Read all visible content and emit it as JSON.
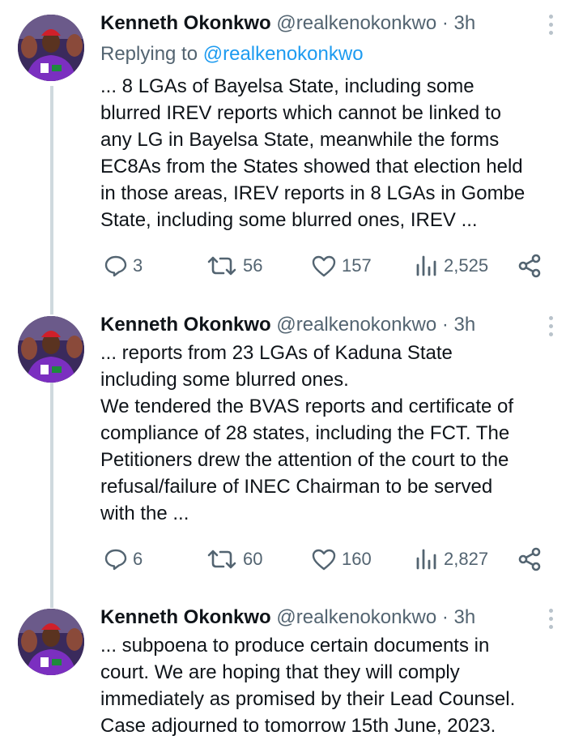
{
  "tweets": [
    {
      "name": "Kenneth Okonkwo",
      "handle": "@realkenokonkwo",
      "dot": "·",
      "time": "3h",
      "replying_prefix": "Replying to",
      "replying_to": "@realkenokonkwo",
      "lines": [
        "... 8 LGAs of Bayelsa State, including some",
        "blurred IREV reports which cannot be linked to",
        "any LG in Bayelsa State, meanwhile the forms",
        "EC8As from the States showed that election held",
        "in those areas, IREV reports in 8 LGAs in Gombe",
        "State, including some blurred ones, IREV ..."
      ],
      "stats": {
        "replies": "3",
        "reposts": "56",
        "likes": "157",
        "views": "2,525"
      }
    },
    {
      "name": "Kenneth Okonkwo",
      "handle": "@realkenokonkwo",
      "dot": "·",
      "time": "3h",
      "lines": [
        "... reports from 23 LGAs of Kaduna State",
        "including some blurred ones.",
        "We tendered the BVAS reports and certificate of",
        "compliance of 28 states, including the FCT. The",
        "Petitioners drew the attention of the court to the",
        "refusal/failure of INEC Chairman to be served",
        "with the ..."
      ],
      "stats": {
        "replies": "6",
        "reposts": "60",
        "likes": "160",
        "views": "2,827"
      }
    },
    {
      "name": "Kenneth Okonkwo",
      "handle": "@realkenokonkwo",
      "dot": "·",
      "time": "3h",
      "lines": [
        "... subpoena to produce certain documents in",
        "court. We are hoping that they will comply",
        "immediately as promised by their Lead Counsel.",
        "Case adjourned to tomorrow 15th June, 2023."
      ]
    }
  ],
  "icons": {
    "reply": "reply-icon",
    "repost": "repost-icon",
    "like": "heart-icon",
    "views": "views-icon",
    "share": "share-icon",
    "more": "more-vertical-icon"
  },
  "colors": {
    "name": "#0f1419",
    "secondary": "#536471",
    "link": "#1d9bf0",
    "thread_line": "#cfd9de"
  }
}
